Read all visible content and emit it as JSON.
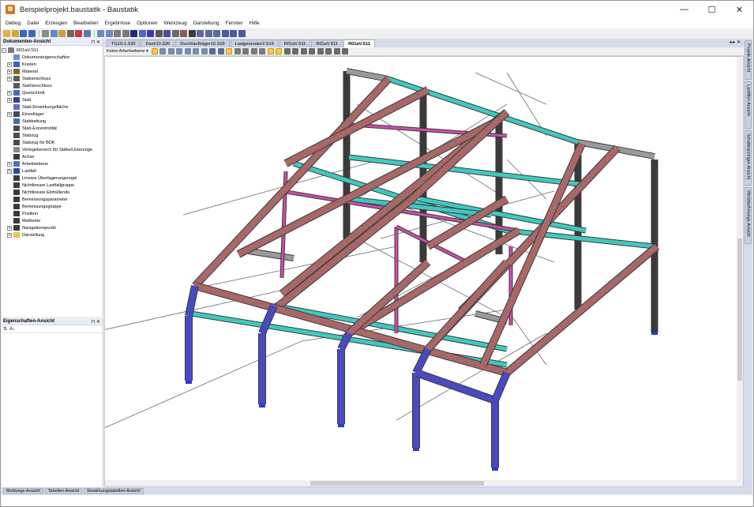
{
  "window": {
    "title": "Beispielprojekt.baustatik - Baustatik",
    "controls": {
      "minimize": "—",
      "maximize": "☐",
      "close": "✕"
    }
  },
  "menu": [
    "Debug",
    "Datei",
    "Erzeugen",
    "Bearbeiten",
    "Ergebnisse",
    "Optionen",
    "Werkzeug",
    "Darstellung",
    "Fenster",
    "Hilfe"
  ],
  "document_panel": {
    "title": "Dokumenten-Ansicht",
    "controls": "⊓ ✕",
    "root": "R01aV.S11",
    "items": [
      {
        "label": "Dokumenteigenschaften",
        "icon": "document-icon",
        "expandable": false,
        "color": "#6d8fc7"
      },
      {
        "label": "Knoten",
        "icon": "node-icon",
        "expandable": true,
        "color": "#3e5bd0"
      },
      {
        "label": "Material",
        "icon": "material-icon",
        "expandable": true,
        "color": "#7a6a3a"
      },
      {
        "label": "Stabanschluss",
        "icon": "member-joint-icon",
        "expandable": true,
        "color": "#5a5a5a"
      },
      {
        "label": "Stahlanschluss",
        "icon": "steel-joint-icon",
        "expandable": false,
        "color": "#5a5a5a"
      },
      {
        "label": "Querschnitt",
        "icon": "cross-section-icon",
        "expandable": true,
        "color": "#4a68b8"
      },
      {
        "label": "Stab",
        "icon": "member-icon",
        "expandable": true,
        "color": "#3a3a9a"
      },
      {
        "label": "Stab-Einwirkungsfläche",
        "icon": "action-area-icon",
        "expandable": false,
        "color": "#6a6ac0"
      },
      {
        "label": "Einzellager",
        "icon": "support-icon",
        "expandable": true,
        "color": "#4a4a4a"
      },
      {
        "label": "Stabbettung",
        "icon": "bedding-icon",
        "expandable": false,
        "color": "#4a6ab0"
      },
      {
        "label": "Stab-Exzentrizität",
        "icon": "eccentricity-icon",
        "expandable": false,
        "color": "#4a4a4a"
      },
      {
        "label": "Stabzug",
        "icon": "polyline-icon",
        "expandable": false,
        "color": "#4a4a4a"
      },
      {
        "label": "Stabzug für BDK",
        "icon": "polyline-bdk-icon",
        "expandable": false,
        "color": "#4a4a4a"
      },
      {
        "label": "Verlegebereich für Stäbe/Unterzüge",
        "icon": "laying-area-icon",
        "expandable": false,
        "color": "#8a8a8a"
      },
      {
        "label": "Achse",
        "icon": "axis-icon",
        "expandable": false,
        "color": "#3a3a3a"
      },
      {
        "label": "Arbeitsebene",
        "icon": "work-plane-icon",
        "expandable": true,
        "color": "#5070c0"
      },
      {
        "label": "Lastfall",
        "icon": "load-case-icon",
        "expandable": true,
        "color": "#2a4aa0"
      },
      {
        "label": "Lineare Überlagerungsregel",
        "icon": "linear-rule-icon",
        "expandable": false,
        "color": "#3a3a3a"
      },
      {
        "label": "Nichtlineare Lastfallgruppe",
        "icon": "nonlinear-group-icon",
        "expandable": false,
        "color": "#3a3a3a"
      },
      {
        "label": "Nichtlineare Einhüllende",
        "icon": "nonlinear-envelope-icon",
        "expandable": false,
        "color": "#3a3a3a"
      },
      {
        "label": "Bemessungsparameter",
        "icon": "design-param-icon",
        "expandable": false,
        "color": "#3a3a3a"
      },
      {
        "label": "Bemessungsgruppe",
        "icon": "design-group-icon",
        "expandable": false,
        "color": "#3a3a3a"
      },
      {
        "label": "Position",
        "icon": "position-icon",
        "expandable": false,
        "color": "#3a3a3a"
      },
      {
        "label": "Maßkette",
        "icon": "dimension-icon",
        "expandable": false,
        "color": "#3a3a3a"
      },
      {
        "label": "Navigationspunkt",
        "icon": "nav-point-icon",
        "expandable": true,
        "color": "#3a3a3a"
      },
      {
        "label": "Darstellung",
        "icon": "folder-icon",
        "expandable": true,
        "color": "#e9c44a"
      }
    ]
  },
  "properties_panel": {
    "title": "Eigenschaften-Ansicht",
    "controls": "⊓ ✕",
    "tools": [
      "⇅",
      "A↓"
    ]
  },
  "tabs": [
    {
      "label": "TG10-1.S20",
      "active": false
    },
    {
      "label": "Dach10.S20",
      "active": false
    },
    {
      "label": "Durchlaufträger16.S09",
      "active": false
    },
    {
      "label": "Lastgenerator2.S19",
      "active": false
    },
    {
      "label": "R01aV.S11",
      "active": false
    },
    {
      "label": "R01aV.S11",
      "active": false
    },
    {
      "label": "R01aV.S11",
      "active": true
    }
  ],
  "tabs_controls": "◂ ▸ ✕",
  "view_toolbar": {
    "workplane_select": "Keine Arbeitsebene ▾"
  },
  "side_tabs": [
    "Projekt-Ansicht",
    "Lastfilter-Ansicht",
    "Schalteanzeiger-Ansicht",
    "Wertebefreiungs-Ansicht"
  ],
  "bottom_tabs": [
    "Meldungs-Ansicht",
    "Tabellen-Ansicht",
    "Einwirkungstabellen-Ansicht"
  ],
  "colors": {
    "rafter": "#a86868",
    "purlin": "#40c8c0",
    "column_dark": "#3a3a3a",
    "column_blue": "#4a4ac0",
    "bracing": "#c850a8",
    "roof_edge": "#9a9a9a",
    "cable": "#6a6a6a"
  }
}
